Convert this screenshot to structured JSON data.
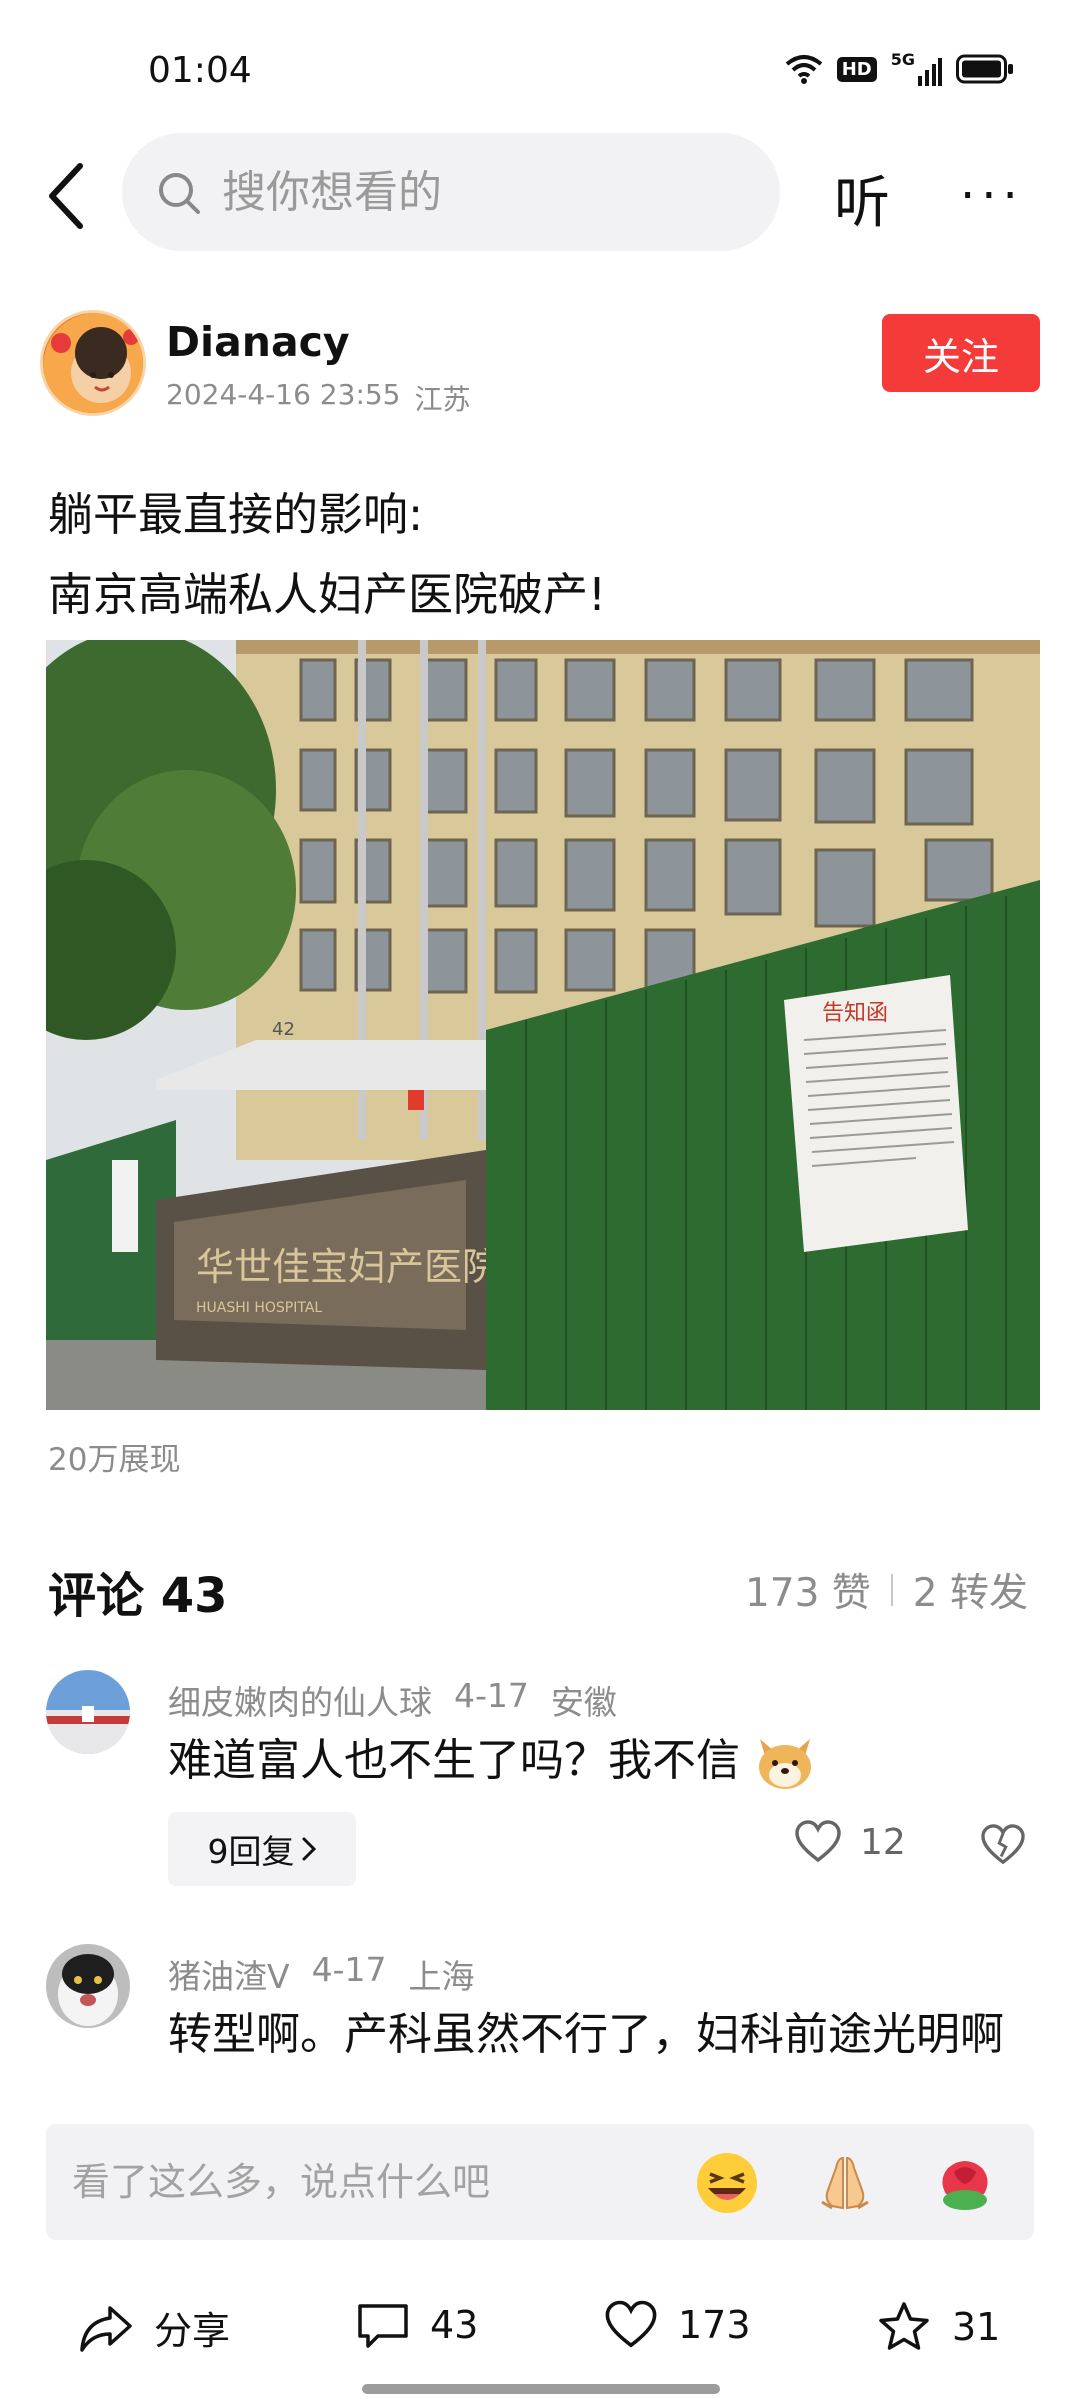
{
  "status_bar": {
    "time": "01:04",
    "hd": "HD",
    "network": "5G"
  },
  "search": {
    "placeholder": "搜你想看的"
  },
  "nav": {
    "listen_label": "听",
    "more_label": "···"
  },
  "author": {
    "name": "Dianacy",
    "date": "2024-4-16 23:55",
    "location": "江苏",
    "follow_label": "关注"
  },
  "post": {
    "lines": [
      "躺平最直接的影响:",
      "南京高端私人妇产医院破产!"
    ],
    "photo": {
      "sign_text": "华世佳宝妇产医院",
      "sign_english": "HUASHI HOSPITAL",
      "notice_title": "告知函",
      "building_number": "42"
    },
    "views": "20万展现"
  },
  "comments_header": {
    "title": "评论 43",
    "likes": "173 赞",
    "reposts": "2 转发"
  },
  "comments": [
    {
      "user": "细皮嫩肉的仙人球",
      "date": "4-17",
      "location": "安徽",
      "text": "难道富人也不生了吗？我不信",
      "reply_label": "9回复",
      "likes": "12"
    },
    {
      "user": "猪油渣V",
      "date": "4-17",
      "location": "上海",
      "text": "转型啊。产科虽然不行了，妇科前途光明啊"
    }
  ],
  "comment_input": {
    "placeholder": "看了这么多，说点什么吧"
  },
  "bottom_bar": {
    "share_label": "分享",
    "comments_count": "43",
    "likes_count": "173",
    "favorites_count": "31"
  },
  "colors": {
    "accent": "#f53a3a",
    "muted_text": "#8c8c8c",
    "panel_bg": "#f2f2f4"
  }
}
